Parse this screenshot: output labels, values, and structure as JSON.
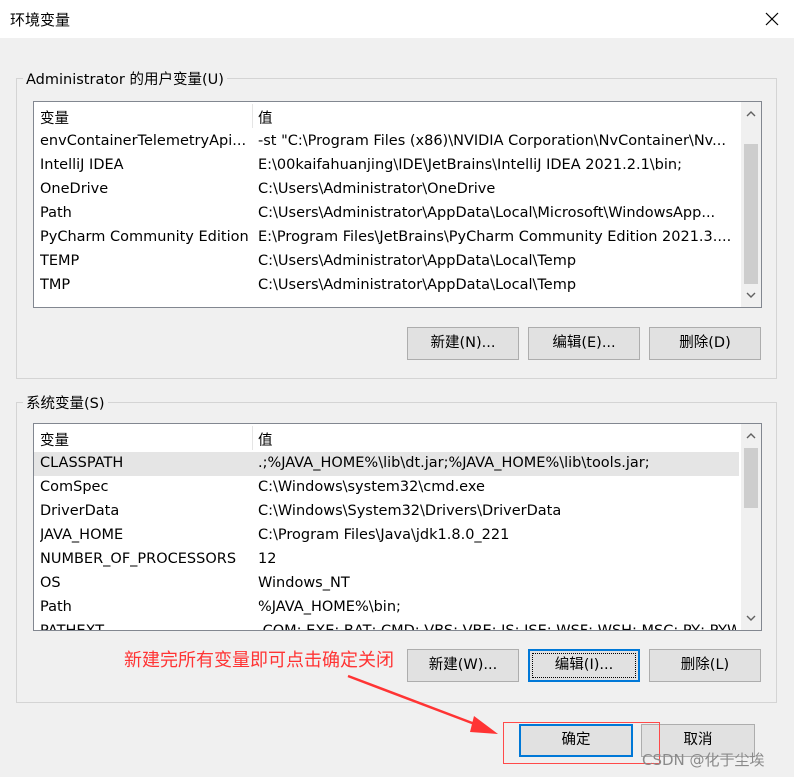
{
  "window": {
    "title": "环境变量",
    "close_icon": "close-icon"
  },
  "user_vars": {
    "group_label": "Administrator 的用户变量(U)",
    "headers": [
      "变量",
      "值"
    ],
    "rows": [
      {
        "name": "envContainerTelemetryApi...",
        "value": "-st \"C:\\Program Files (x86)\\NVIDIA Corporation\\NvContainer\\Nv..."
      },
      {
        "name": "IntelliJ IDEA",
        "value": "E:\\00kaifahuanjing\\IDE\\JetBrains\\IntelliJ IDEA 2021.2.1\\bin;"
      },
      {
        "name": "OneDrive",
        "value": "C:\\Users\\Administrator\\OneDrive"
      },
      {
        "name": "Path",
        "value": "C:\\Users\\Administrator\\AppData\\Local\\Microsoft\\WindowsApp..."
      },
      {
        "name": "PyCharm Community Edition",
        "value": "E:\\Program Files\\JetBrains\\PyCharm Community Edition 2021.3...."
      },
      {
        "name": "TEMP",
        "value": "C:\\Users\\Administrator\\AppData\\Local\\Temp"
      },
      {
        "name": "TMP",
        "value": "C:\\Users\\Administrator\\AppData\\Local\\Temp"
      }
    ],
    "buttons": {
      "new": "新建(N)...",
      "edit": "编辑(E)...",
      "delete": "删除(D)"
    }
  },
  "system_vars": {
    "group_label": "系统变量(S)",
    "headers": [
      "变量",
      "值"
    ],
    "rows": [
      {
        "name": "CLASSPATH",
        "value": ".;%JAVA_HOME%\\lib\\dt.jar;%JAVA_HOME%\\lib\\tools.jar;"
      },
      {
        "name": "ComSpec",
        "value": "C:\\Windows\\system32\\cmd.exe"
      },
      {
        "name": "DriverData",
        "value": "C:\\Windows\\System32\\Drivers\\DriverData"
      },
      {
        "name": "JAVA_HOME",
        "value": "C:\\Program Files\\Java\\jdk1.8.0_221"
      },
      {
        "name": "NUMBER_OF_PROCESSORS",
        "value": "12"
      },
      {
        "name": "OS",
        "value": "Windows_NT"
      },
      {
        "name": "Path",
        "value": "%JAVA_HOME%\\bin;"
      },
      {
        "name": "PATHEXT",
        "value": ".COM;.EXE;.BAT;.CMD;.VBS;.VBE;.JS;.JSE;.WSF;.WSH;.MSC;.PY;.PYW"
      }
    ],
    "selected_index": 0,
    "buttons": {
      "new": "新建(W)...",
      "edit": "编辑(I)...",
      "delete": "删除(L)"
    }
  },
  "footer": {
    "ok": "确定",
    "cancel": "取消"
  },
  "annotation": {
    "text": "新建完所有变量即可点击确定关闭",
    "color": "#ff3434"
  },
  "watermark": "CSDN @化于尘埃",
  "colors": {
    "focus": "#0078d7",
    "selected_row": "#e5e5e5",
    "annotation_red": "#ff3434"
  }
}
